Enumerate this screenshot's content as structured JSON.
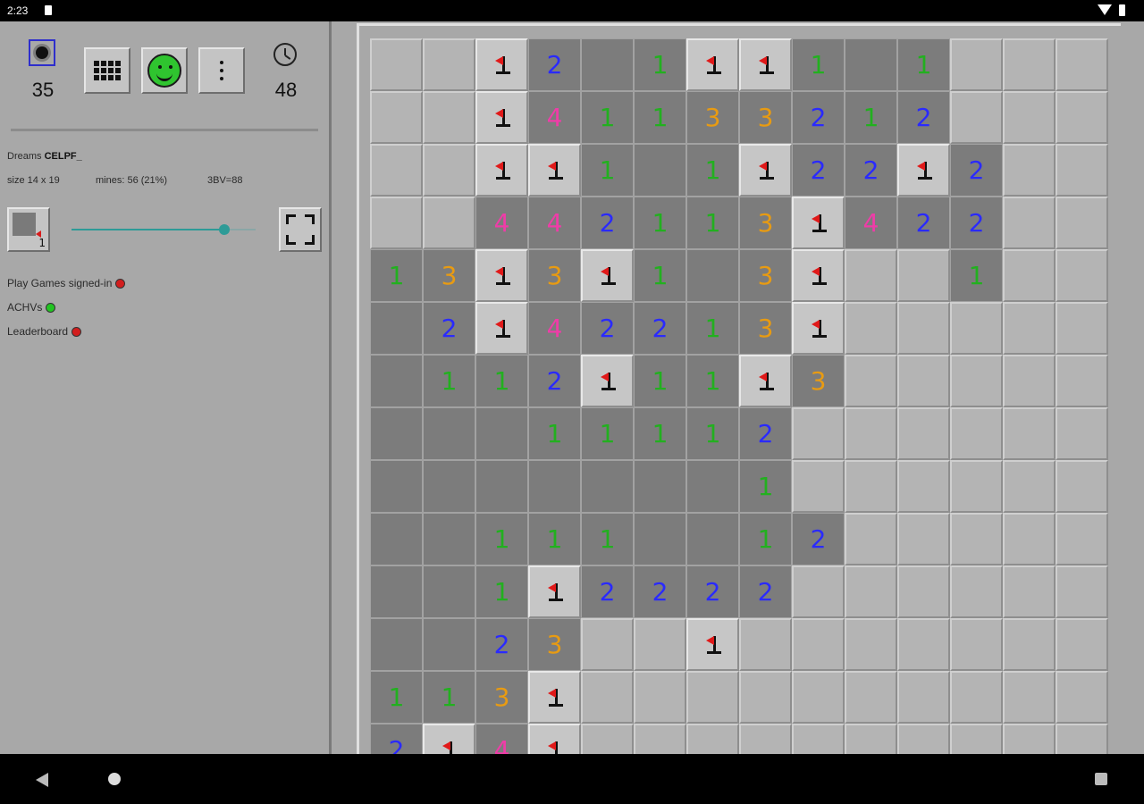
{
  "status_bar": {
    "time": "2:23"
  },
  "header": {
    "mines_remaining": "35",
    "timer": "48"
  },
  "game_info": {
    "prefix": "Dreams",
    "code": "CELPF_",
    "size": "size 14 x 19",
    "mines": "mines: 56 (21%)",
    "bv": "3BV=88"
  },
  "zoom": {
    "thumb_label": "1",
    "slider_level": 0.85
  },
  "services": [
    {
      "label": "Play Games signed-in",
      "color": "#d21e1e"
    },
    {
      "label": "ACHVs",
      "color": "#22c422"
    },
    {
      "label": "Leaderboard",
      "color": "#d21e1e"
    }
  ],
  "colors": {
    "n1": "#22b01f",
    "n2": "#2a2aff",
    "n3": "#e89b12",
    "n4": "#ef3ca8",
    "flag": "#e01919",
    "smiley": "#2fc42f"
  },
  "board": {
    "legend": "h = hidden, f = flag, o = opened empty, digits = number",
    "rows": [
      [
        "h",
        "h",
        "f",
        "2",
        "o",
        "1",
        "f",
        "f",
        "1",
        "o",
        "1",
        "h",
        "h",
        "h"
      ],
      [
        "h",
        "h",
        "f",
        "4",
        "1",
        "1",
        "3",
        "3",
        "2",
        "1",
        "2",
        "h",
        "h",
        "h"
      ],
      [
        "h",
        "h",
        "f",
        "f",
        "1",
        "o",
        "1",
        "f",
        "2",
        "2",
        "f",
        "2",
        "h",
        "h"
      ],
      [
        "h",
        "h",
        "4",
        "4",
        "2",
        "1",
        "1",
        "3",
        "f",
        "4",
        "2",
        "2",
        "h",
        "h"
      ],
      [
        "1",
        "3",
        "f",
        "3",
        "f",
        "1",
        "o",
        "3",
        "f",
        "h",
        "h",
        "1",
        "h",
        "h"
      ],
      [
        "o",
        "2",
        "f",
        "4",
        "2",
        "2",
        "1",
        "3",
        "f",
        "h",
        "h",
        "h",
        "h",
        "h"
      ],
      [
        "o",
        "1",
        "1",
        "2",
        "f",
        "1",
        "1",
        "f",
        "3",
        "h",
        "h",
        "h",
        "h",
        "h"
      ],
      [
        "o",
        "o",
        "o",
        "1",
        "1",
        "1",
        "1",
        "2",
        "h",
        "h",
        "h",
        "h",
        "h",
        "h"
      ],
      [
        "o",
        "o",
        "o",
        "o",
        "o",
        "o",
        "o",
        "1",
        "h",
        "h",
        "h",
        "h",
        "h",
        "h"
      ],
      [
        "o",
        "o",
        "1",
        "1",
        "1",
        "o",
        "o",
        "1",
        "2",
        "h",
        "h",
        "h",
        "h",
        "h"
      ],
      [
        "o",
        "o",
        "1",
        "f",
        "2",
        "2",
        "2",
        "2",
        "h",
        "h",
        "h",
        "h",
        "h",
        "h"
      ],
      [
        "o",
        "o",
        "2",
        "3",
        "h",
        "h",
        "f",
        "h",
        "h",
        "h",
        "h",
        "h",
        "h",
        "h"
      ],
      [
        "1",
        "1",
        "3",
        "f",
        "h",
        "h",
        "h",
        "h",
        "h",
        "h",
        "h",
        "h",
        "h",
        "h"
      ],
      [
        "2",
        "f",
        "4",
        "f",
        "h",
        "h",
        "h",
        "h",
        "h",
        "h",
        "h",
        "h",
        "h",
        "h"
      ]
    ]
  }
}
